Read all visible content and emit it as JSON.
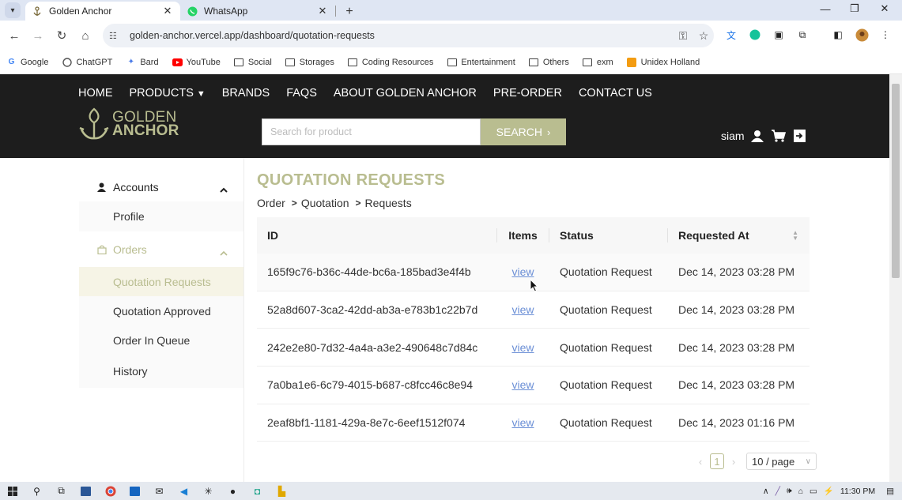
{
  "browser": {
    "tabs": [
      {
        "title": "Golden Anchor",
        "active": true
      },
      {
        "title": "WhatsApp",
        "active": false
      }
    ],
    "url": "golden-anchor.vercel.app/dashboard/quotation-requests",
    "bookmarks": [
      "Google",
      "ChatGPT",
      "Bard",
      "YouTube",
      "Social",
      "Storages",
      "Coding Resources",
      "Entertainment",
      "Others",
      "exm",
      "Unidex Holland"
    ]
  },
  "site": {
    "nav": [
      "HOME",
      "PRODUCTS",
      "BRANDS",
      "FAQS",
      "ABOUT GOLDEN ANCHOR",
      "PRE-ORDER",
      "CONTACT US"
    ],
    "logo": {
      "line1": "GOLDEN",
      "line2": "ANCHOR"
    },
    "search": {
      "placeholder": "Search for product",
      "button": "SEARCH"
    },
    "user": "siam"
  },
  "sidebar": {
    "accounts": "Accounts",
    "profile": "Profile",
    "orders": "Orders",
    "items": [
      "Quotation Requests",
      "Quotation Approved",
      "Order In Queue",
      "History"
    ]
  },
  "main": {
    "title": "QUOTATION REQUESTS",
    "breadcrumb": [
      "Order",
      "Quotation",
      "Requests"
    ],
    "columns": {
      "id": "ID",
      "items": "Items",
      "status": "Status",
      "requested_at": "Requested At"
    },
    "rows": [
      {
        "id": "165f9c76-b36c-44de-bc6a-185bad3e4f4b",
        "items": "view",
        "status": "Quotation Request",
        "date": "Dec 14, 2023 03:28 PM"
      },
      {
        "id": "52a8d607-3ca2-42dd-ab3a-e783b1c22b7d",
        "items": "view",
        "status": "Quotation Request",
        "date": "Dec 14, 2023 03:28 PM"
      },
      {
        "id": "242e2e80-7d32-4a4a-a3e2-490648c7d84c",
        "items": "view",
        "status": "Quotation Request",
        "date": "Dec 14, 2023 03:28 PM"
      },
      {
        "id": "7a0ba1e6-6c79-4015-b687-c8fcc46c8e94",
        "items": "view",
        "status": "Quotation Request",
        "date": "Dec 14, 2023 03:28 PM"
      },
      {
        "id": "2eaf8bf1-1181-429a-8e7c-6eef1512f074",
        "items": "view",
        "status": "Quotation Request",
        "date": "Dec 14, 2023 01:16 PM"
      }
    ],
    "pagination": {
      "current": "1",
      "page_size": "10 / page"
    }
  },
  "taskbar": {
    "time": "11:30 PM"
  },
  "colors": {
    "accent": "#b9bd90",
    "header_bg": "#1d1d1d",
    "link": "#6b8fd6"
  }
}
